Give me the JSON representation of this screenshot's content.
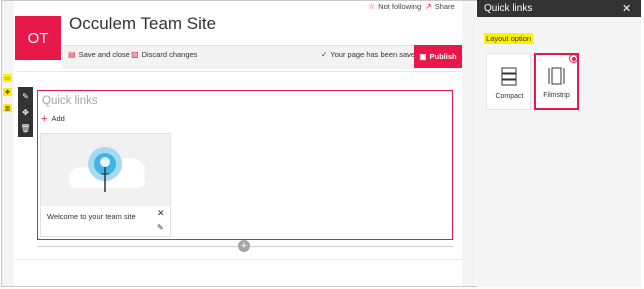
{
  "header": {
    "logo_initials": "OT",
    "site_title": "Occulem Team Site",
    "follow_label": "Not following",
    "share_label": "Share"
  },
  "command_bar": {
    "save_close_label": "Save and close",
    "discard_label": "Discard changes",
    "status_text": "Your page has been saved",
    "publish_label": "Publish"
  },
  "webpart": {
    "title": "Quick links",
    "add_label": "Add",
    "card_text": "Welcome to your team site"
  },
  "panel": {
    "title": "Quick links",
    "layout_label": "Layout option",
    "options": [
      {
        "label": "Compact",
        "selected": false
      },
      {
        "label": "Filmstrip",
        "selected": true
      }
    ]
  },
  "colors": {
    "accent": "#e8194a",
    "highlight": "#ffef00",
    "panel_header": "#333333"
  },
  "icons": [
    "star-icon",
    "share-icon",
    "save-icon",
    "discard-icon",
    "check-icon",
    "publish-icon",
    "edit-icon",
    "move-icon",
    "delete-icon",
    "add-icon",
    "close-icon",
    "lightbulb-icon",
    "compact-layout-icon",
    "filmstrip-layout-icon"
  ]
}
